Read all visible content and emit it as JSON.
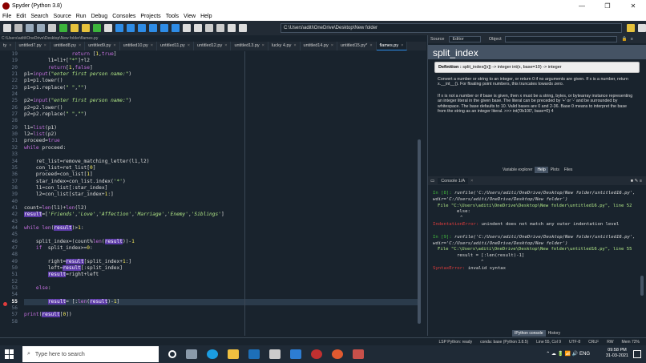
{
  "window": {
    "title": "Spyder (Python 3.8)",
    "minimize": "—",
    "maximize": "❐",
    "close": "✕"
  },
  "menu": [
    "File",
    "Edit",
    "Search",
    "Source",
    "Run",
    "Debug",
    "Consoles",
    "Projects",
    "Tools",
    "View",
    "Help"
  ],
  "toolbar": {
    "path": "C:\\Users\\aditi\\OneDrive\\Desktop\\New folder"
  },
  "editor": {
    "filepath": "C:\\Users\\aditi\\OneDrive\\Desktop\\New folder\\flames.py",
    "tabs": [
      {
        "label": "ty",
        "active": false
      },
      {
        "label": "untitled7.py",
        "active": false
      },
      {
        "label": "untitled8.py",
        "active": false
      },
      {
        "label": "untitled9.py",
        "active": false
      },
      {
        "label": "untitled10.py",
        "active": false
      },
      {
        "label": "untitled11.py",
        "active": false
      },
      {
        "label": "untitled12.py",
        "active": false
      },
      {
        "label": "untitled13.py",
        "active": false
      },
      {
        "label": "lucky 4.py",
        "active": false
      },
      {
        "label": "untitled14.py",
        "active": false
      },
      {
        "label": "untitled15.py*",
        "active": false
      },
      {
        "label": "flames.py",
        "active": true
      }
    ],
    "current_line": 55
  },
  "help": {
    "source_label": "Source",
    "source_value": "Editor",
    "object_label": "Object",
    "title": "split_index",
    "definition_label": "Definition :",
    "definition": "split_index([x]) -> integer int(x, base=10) -> integer",
    "para1": "Convert a number or string to an integer, or return 0 if no arguments are given. If x is a number, return x.__int__(). For floating point numbers, this truncates towards zero.",
    "para2": "If x is not a number or if base is given, then x must be a string, bytes, or bytearray instance representing an integer literal in the given base. The literal can be preceded by '+' or '-' and be surrounded by whitespace. The base defaults to 10. Valid bases are 0 and 2-36. Base 0 means to interpret the base from the string as an integer literal. >>> int('0b100', base=0) 4",
    "pane_tabs": [
      "Variable explorer",
      "Help",
      "Plots",
      "Files"
    ]
  },
  "console": {
    "tab": "Console 1/A",
    "entries": [
      {
        "prompt": "In [8]:",
        "call": "runfile('C:/Users/aditi/OneDrive/Desktop/New folder/untitled16.py', wdir='C:/Users/aditi/OneDrive/Desktop/New folder')",
        "file": "File \"C:\\Users\\aditi\\OneDrive\\Desktop\\New folder\\untitled16.py\", line 52",
        "src": "else:",
        "caret": "^",
        "error_type": "IndentationError:",
        "error_msg": " unindent does not match any outer indentation level"
      },
      {
        "prompt": "In [9]:",
        "call": "runfile('C:/Users/aditi/OneDrive/Desktop/New folder/untitled16.py', wdir='C:/Users/aditi/OneDrive/Desktop/New folder')",
        "file": "File \"C:\\Users\\aditi\\OneDrive\\Desktop\\New folder\\untitled16.py\", line 55",
        "src": "result = [:len(result)-1]",
        "caret": "^",
        "error_type": "SyntaxError:",
        "error_msg": " invalid syntax"
      }
    ],
    "bottom_tabs": [
      "IPython console",
      "History"
    ]
  },
  "status": {
    "lsp": "LSP Python: ready",
    "conda": "conda: base (Python 3.8.5)",
    "position": "Line 55, Col 9",
    "encoding": "UTF-8",
    "eol": "CRLF",
    "rw": "RW",
    "mem": "Mem 72%"
  },
  "taskbar": {
    "search_placeholder": "Type here to search",
    "lang": "ENG",
    "time": "09:58 PM",
    "date": "31-03-2021"
  },
  "colors": {
    "accent": "#2e8ce6",
    "error": "#e03c3c",
    "prompt": "#42b83d",
    "highlight": "#5c3aa8"
  }
}
